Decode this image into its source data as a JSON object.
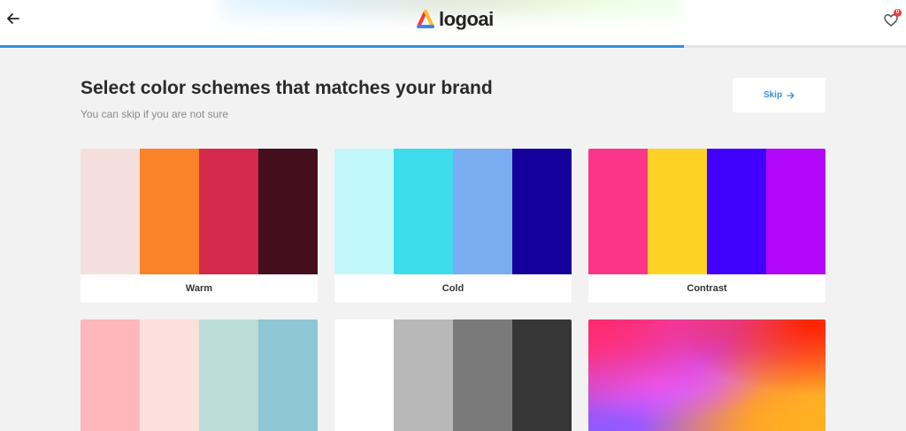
{
  "header": {
    "back_icon": "arrow-left-icon",
    "logo_text": "logoai",
    "favorites_icon": "heart-icon",
    "favorites_count": "0",
    "progress": 0.755
  },
  "main": {
    "title": "Select color schemes that matches your brand",
    "subtitle": "You can skip if you are not sure",
    "skip_label": "Skip",
    "skip_icon": "arrow-right-icon"
  },
  "schemes": [
    {
      "label": "Warm",
      "colors": [
        "#f5dfdd",
        "#f98328",
        "#d4294b",
        "#440e1d"
      ]
    },
    {
      "label": "Cold",
      "colors": [
        "#c2f8fb",
        "#3cdceb",
        "#7aacf0",
        "#14009b"
      ]
    },
    {
      "label": "Contrast",
      "colors": [
        "#fb3689",
        "#fdd225",
        "#4100fd",
        "#b207fb"
      ]
    },
    {
      "label": "",
      "colors": [
        "#feb5bb",
        "#fbe1dc",
        "#bcdcd7",
        "#8ec6d3"
      ]
    },
    {
      "label": "",
      "colors": [
        "#ffffff",
        "#b8b8b8",
        "#7a7a7a",
        "#363636"
      ]
    },
    {
      "label": "",
      "colors": [
        "gradient"
      ]
    }
  ]
}
